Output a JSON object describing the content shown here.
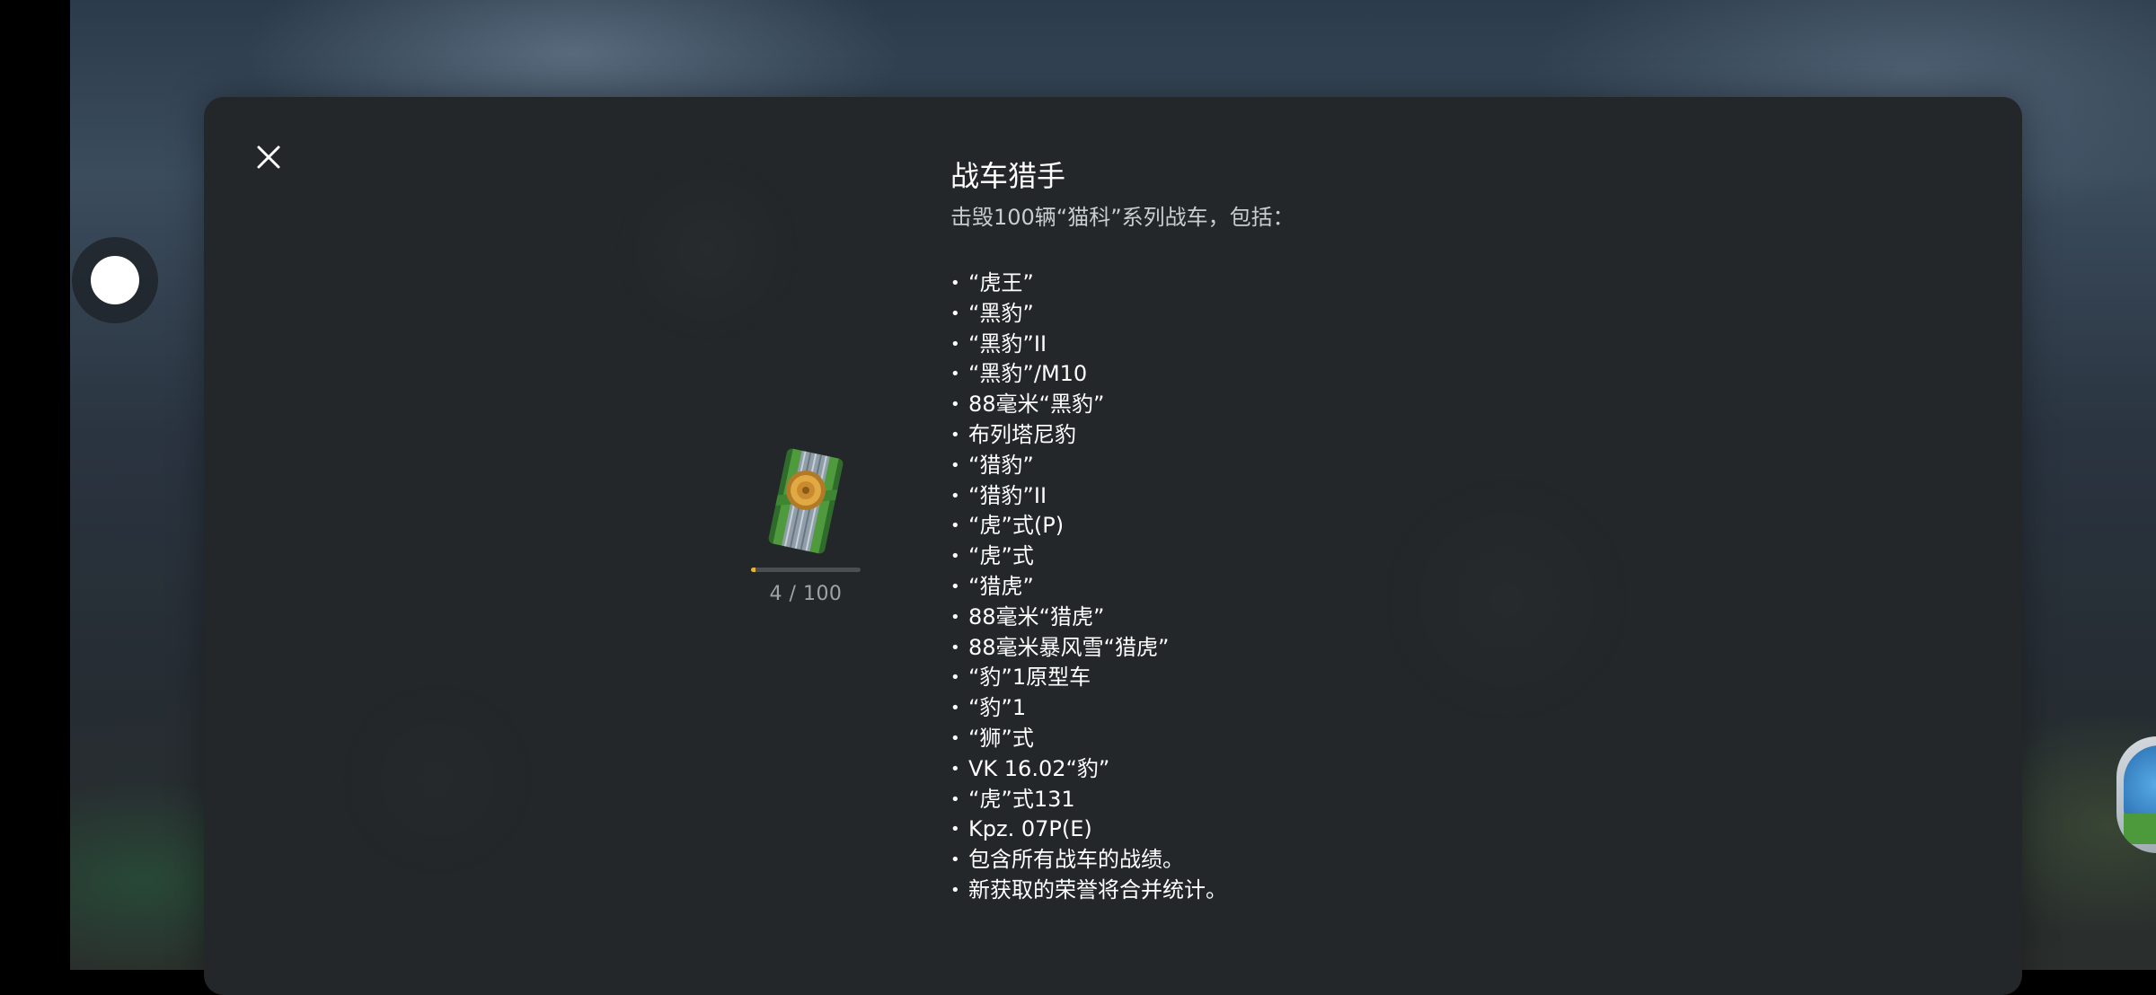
{
  "dialog": {
    "title": "战车猎手",
    "description": "击毁100辆“猫科”系列战车，包括：",
    "close_icon": "close-icon"
  },
  "achievement": {
    "icon": "medal-icon",
    "progress_current": 4,
    "progress_total": 100,
    "progress_text": "4 / 100",
    "progress_fraction": 0.04
  },
  "items": [
    "“虎王”",
    "“黑豹”",
    "“黑豹”II",
    "“黑豹”/M10",
    "88毫米“黑豹”",
    "布列塔尼豹",
    "“猎豹”",
    "“猎豹”II",
    "“虎”式(P)",
    "“虎”式",
    "“猎虎”",
    "88毫米“猎虎”",
    "88毫米暴风雪“猎虎”",
    "“豹”1原型车",
    "“豹”1",
    "“狮”式",
    "VK 16.02“豹”",
    "“虎”式131",
    "Kpz. 07P(E)",
    "包含所有战车的战绩。",
    "新获取的荣誉将合并统计。"
  ],
  "colors": {
    "modal_bg": "#232729",
    "progress_fill": "#e2b53a",
    "progress_track": "#4a4f53"
  }
}
